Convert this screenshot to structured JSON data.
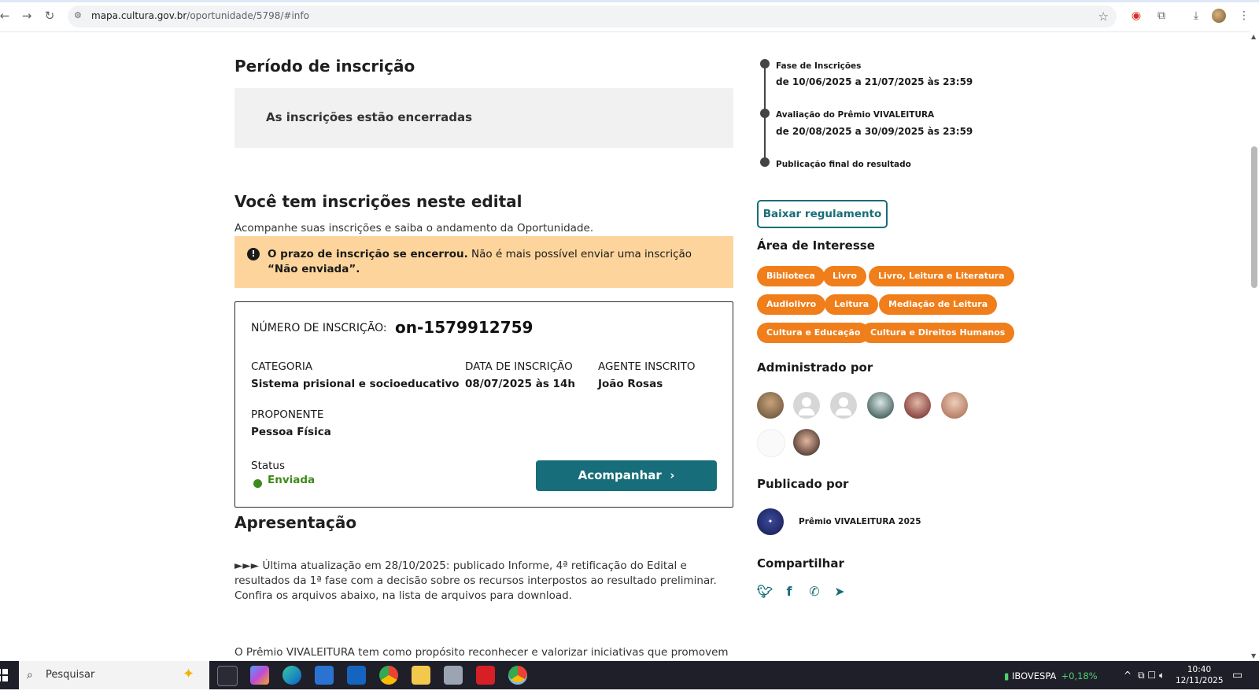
{
  "browser": {
    "url_host": "mapa.cultura.gov.br",
    "url_path": "/oportunidade/5798/#info"
  },
  "left": {
    "periodo_title": "Período de inscrição",
    "closed_text": "As inscrições estão encerradas",
    "inscricoes_title": "Você tem inscrições neste edital",
    "inscricoes_sub": "Acompanhe suas inscrições e saiba o andamento da Oportunidade.",
    "alert": {
      "bold": "O prazo de inscrição se encerrou.",
      "text": " Não é mais possível enviar uma inscrição ",
      "bold2": "“Não enviada”."
    },
    "card": {
      "num_label": "NÚMERO DE INSCRIÇÃO:",
      "num_value": "on-1579912759",
      "categoria_label": "CATEGORIA",
      "categoria_value": "Sistema prisional e socioeducativo",
      "data_label": "DATA DE INSCRIÇÃO",
      "data_value": "08/07/2025 às 14h",
      "agente_label": "AGENTE INSCRITO",
      "agente_value": "João Rosas",
      "proponente_label": "PROPONENTE",
      "proponente_value": "Pessoa Física",
      "status_label": "Status",
      "status_value": "Enviada",
      "button": "Acompanhar"
    },
    "apresentacao_title": "Apresentação",
    "para1": "►►► Última atualização em 28/10/2025: publicado Informe, 4ª retificação do Edital e resultados da 1ª fase com a decisão sobre os recursos interpostos ao resultado preliminar. Confira os arquivos abaixo, na lista de arquivos para download.",
    "para2": "O Prêmio VIVALEITURA tem como propósito reconhecer e valorizar iniciativas que promovem a"
  },
  "right": {
    "timeline": [
      {
        "title": "Fase de Inscrições",
        "date": "de 10/06/2025 a 21/07/2025 às 23:59"
      },
      {
        "title": "Avaliação do Prêmio VIVALEITURA",
        "date": "de 20/08/2025 a 30/09/2025 às 23:59"
      },
      {
        "title": "Publicação final do resultado",
        "date": ""
      }
    ],
    "download_button": "Baixar regulamento",
    "area_title": "Área de Interesse",
    "tags": [
      "Biblioteca",
      "Livro",
      "Livro, Leitura e Literatura",
      "Audiolivro",
      "Leitura",
      "Mediação de Leitura",
      "Cultura e Educação",
      "Cultura e Direitos Humanos"
    ],
    "admin_title": "Administrado por",
    "publicado_title": "Publicado por",
    "publicado_name": "Prêmio VIVALEITURA 2025",
    "compartilhar_title": "Compartilhar"
  },
  "taskbar": {
    "search_placeholder": "Pesquisar",
    "ibov_label": "IBOVESPA",
    "ibov_pct": "+0,18%",
    "time": "10:40",
    "date": "12/11/2025"
  },
  "colors": {
    "accent": "#176d79",
    "tag": "#f07e1a",
    "alert_bg": "#fdd59c",
    "status_green": "#3f8a1c"
  }
}
